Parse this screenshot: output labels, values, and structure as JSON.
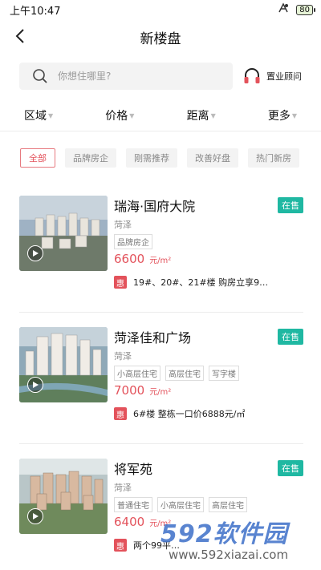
{
  "status": {
    "time": "上午10:47",
    "battery": "80"
  },
  "nav": {
    "title": "新楼盘"
  },
  "search": {
    "placeholder": "你想住哪里?",
    "advisor_label": "置业顾问"
  },
  "filters": [
    {
      "label": "区域"
    },
    {
      "label": "价格"
    },
    {
      "label": "距离"
    },
    {
      "label": "更多"
    }
  ],
  "tags": [
    "全部",
    "品牌房企",
    "刚需推荐",
    "改善好盘",
    "热门新房"
  ],
  "listings": [
    {
      "name": "瑞海·国府大院",
      "status": "在售",
      "city": "菏泽",
      "features": [
        "品牌房企"
      ],
      "price": "6600",
      "price_unit": "元/m²",
      "promo_badge": "惠",
      "promo": "19#、20#、21#楼 购房立享9…"
    },
    {
      "name": "菏泽佳和广场",
      "status": "在售",
      "city": "菏泽",
      "features": [
        "小高层住宅",
        "高层住宅",
        "写字楼"
      ],
      "price": "7000",
      "price_unit": "元/m²",
      "promo_badge": "惠",
      "promo": "6#楼 整栋一口价6888元/㎡"
    },
    {
      "name": "将军苑",
      "status": "在售",
      "city": "菏泽",
      "features": [
        "普通住宅",
        "小高层住宅",
        "高层住宅"
      ],
      "price": "6400",
      "price_unit": "元/m²",
      "promo_badge": "惠",
      "promo": "两个99平…"
    }
  ],
  "watermark": {
    "brand": "592软件园",
    "url": "www.592xiazai.com"
  },
  "colors": {
    "accent": "#e3525b",
    "sale": "#1fb8a2"
  }
}
